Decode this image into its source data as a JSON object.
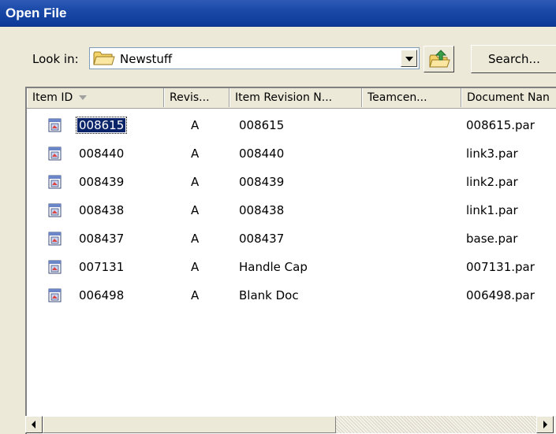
{
  "window": {
    "title": "Open File"
  },
  "look_in": {
    "label": "Look in:",
    "value": "Newstuff"
  },
  "toolbar": {
    "search_label": "Search..."
  },
  "columns": [
    {
      "label": "Item ID",
      "sorted": "descending"
    },
    {
      "label": "Revis..."
    },
    {
      "label": "Item Revision N..."
    },
    {
      "label": "Teamcen..."
    },
    {
      "label": "Document Nan"
    }
  ],
  "rows": [
    {
      "item_id": "008615",
      "revision": "A",
      "revision_name": "008615",
      "teamcenter": "",
      "document_name": "008615.par",
      "selected": true
    },
    {
      "item_id": "008440",
      "revision": "A",
      "revision_name": "008440",
      "teamcenter": "",
      "document_name": "link3.par"
    },
    {
      "item_id": "008439",
      "revision": "A",
      "revision_name": "008439",
      "teamcenter": "",
      "document_name": "link2.par"
    },
    {
      "item_id": "008438",
      "revision": "A",
      "revision_name": "008438",
      "teamcenter": "",
      "document_name": "link1.par"
    },
    {
      "item_id": "008437",
      "revision": "A",
      "revision_name": "008437",
      "teamcenter": "",
      "document_name": "base.par"
    },
    {
      "item_id": "007131",
      "revision": "A",
      "revision_name": "Handle Cap",
      "teamcenter": "",
      "document_name": "007131.par"
    },
    {
      "item_id": "006498",
      "revision": "A",
      "revision_name": "Blank Doc",
      "teamcenter": "",
      "document_name": "006498.par"
    }
  ],
  "colors": {
    "title_bar": "#1a49a8",
    "selection": "#0a246a",
    "dialog_face": "#ece9d8"
  }
}
